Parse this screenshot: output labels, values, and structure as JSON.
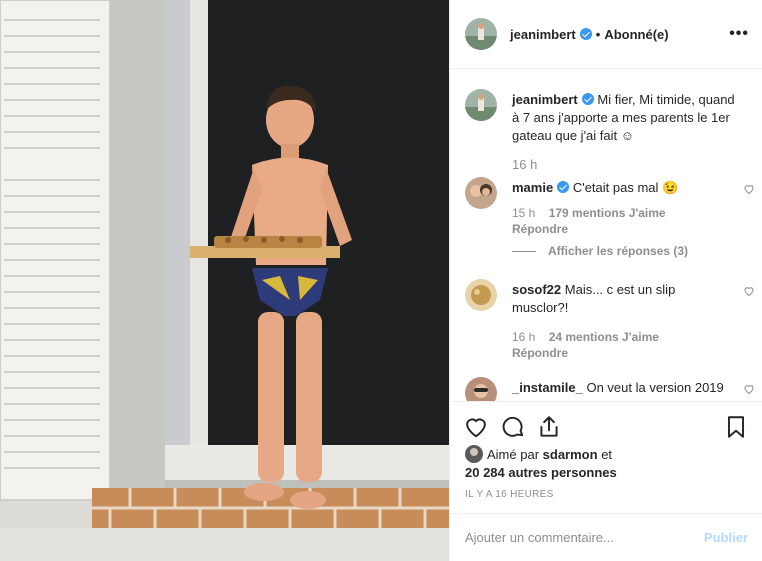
{
  "header": {
    "username": "jeanimbert",
    "separator": "•",
    "follow_status": "Abonné(e)",
    "more": "•••"
  },
  "caption": {
    "username": "jeanimbert",
    "text": "Mi fier, Mi timide, quand à 7 ans j'apporte a mes parents le 1er gateau que j'ai fait ☺",
    "time": "16 h"
  },
  "comments": [
    {
      "username": "mamie",
      "verified": true,
      "text": "C'etait pas mal 😉",
      "time": "15 h",
      "likes": "179 mentions J'aime",
      "reply": "Répondre",
      "view_replies": "Afficher les réponses (3)"
    },
    {
      "username": "sosof22",
      "text": "Mais... c est un slip musclor?!",
      "time": "16 h",
      "likes": "24 mentions J'aime",
      "reply": "Répondre"
    },
    {
      "username": "_instamile_",
      "text": "On veut la version 2019"
    }
  ],
  "actions": {
    "liked_by_prefix": "Aimé par",
    "liked_by_user": "sdarmon",
    "liked_by_suffix": "et",
    "others": "20 284 autres personnes",
    "timestamp": "IL Y A 16 HEURES"
  },
  "add_comment": {
    "placeholder": "Ajouter un commentaire...",
    "publish": "Publier"
  },
  "icons": [
    "heart-icon",
    "comment-icon",
    "share-icon",
    "bookmark-icon",
    "verified-icon"
  ],
  "colors": {
    "verified": "#3897f0",
    "muted": "#8e8e8e",
    "publish_disabled": "#b3dbff",
    "divider": "#efefef"
  }
}
